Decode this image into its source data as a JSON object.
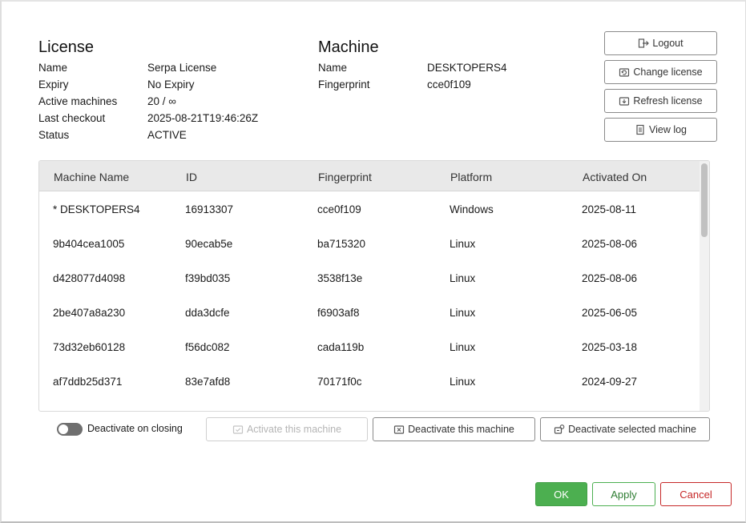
{
  "license": {
    "title": "License",
    "fields": [
      {
        "label": "Name",
        "value": "Serpa License"
      },
      {
        "label": "Expiry",
        "value": "No Expiry"
      },
      {
        "label": "Active machines",
        "value": "20 / ∞"
      },
      {
        "label": "Last checkout",
        "value": "2025-08-21T19:46:26Z"
      },
      {
        "label": "Status",
        "value": "ACTIVE"
      }
    ]
  },
  "machine": {
    "title": "Machine",
    "fields": [
      {
        "label": "Name",
        "value": "DESKTOPERS4"
      },
      {
        "label": "Fingerprint",
        "value": "cce0f109"
      }
    ]
  },
  "side_buttons": [
    {
      "label": "Logout",
      "icon": "logout-icon"
    },
    {
      "label": "Change license",
      "icon": "change-license-icon"
    },
    {
      "label": "Refresh license",
      "icon": "refresh-license-icon"
    },
    {
      "label": "View log",
      "icon": "log-icon"
    }
  ],
  "table": {
    "columns": [
      "Machine Name",
      "ID",
      "Fingerprint",
      "Platform",
      "Activated On"
    ],
    "rows": [
      [
        "* DESKTOPERS4",
        "16913307",
        "cce0f109",
        "Windows",
        "2025-08-11"
      ],
      [
        "9b404cea1005",
        "90ecab5e",
        "ba715320",
        "Linux",
        "2025-08-06"
      ],
      [
        "d428077d4098",
        "f39bd035",
        "3538f13e",
        "Linux",
        "2025-08-06"
      ],
      [
        "2be407a8a230",
        "dda3dcfe",
        "f6903af8",
        "Linux",
        "2025-06-05"
      ],
      [
        "73d32eb60128",
        "f56dc082",
        "cada119b",
        "Linux",
        "2025-03-18"
      ],
      [
        "af7ddb25d371",
        "83e7afd8",
        "70171f0c",
        "Linux",
        "2024-09-27"
      ]
    ]
  },
  "deactivate_toggle": {
    "label": "Deactivate on closing",
    "on": false
  },
  "actions": {
    "activate": "Activate this machine",
    "deactivate": "Deactivate this machine",
    "deactivate_selected": "Deactivate selected machine"
  },
  "footer": {
    "ok": "OK",
    "apply": "Apply",
    "cancel": "Cancel"
  },
  "colors": {
    "ok_green": "#4caf50",
    "cancel_red": "#c62828",
    "toggle_off": "#6f6f6f"
  }
}
